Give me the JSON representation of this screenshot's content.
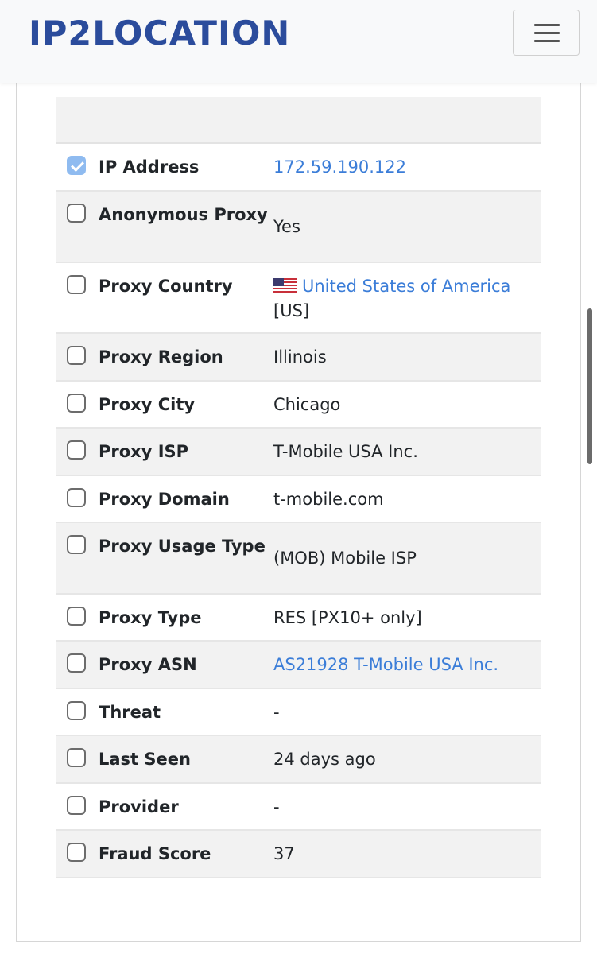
{
  "header": {
    "logo_text": "IP2LOCATION",
    "menu_icon": "hamburger-icon"
  },
  "table": {
    "rows": [
      {
        "label": "IP Address",
        "value": "172.59.190.122",
        "checked": true,
        "link": true
      },
      {
        "label": "Anonymous Proxy",
        "value": "Yes",
        "checked": false,
        "link": false
      },
      {
        "label": "Proxy Country",
        "value": "United States of America",
        "value_suffix": "[US]",
        "checked": false,
        "link": true,
        "flag": "us-flag-icon"
      },
      {
        "label": "Proxy Region",
        "value": "Illinois",
        "checked": false,
        "link": false
      },
      {
        "label": "Proxy City",
        "value": "Chicago",
        "checked": false,
        "link": false
      },
      {
        "label": "Proxy ISP",
        "value": "T-Mobile USA Inc.",
        "checked": false,
        "link": false
      },
      {
        "label": "Proxy Domain",
        "value": "t-mobile.com",
        "checked": false,
        "link": false
      },
      {
        "label": "Proxy Usage Type",
        "value": "(MOB) Mobile ISP",
        "checked": false,
        "link": false
      },
      {
        "label": "Proxy Type",
        "value": "RES [PX10+ only]",
        "checked": false,
        "link": false
      },
      {
        "label": "Proxy ASN",
        "value": "AS21928 T-Mobile USA Inc.",
        "checked": false,
        "link": true
      },
      {
        "label": "Threat",
        "value": "-",
        "checked": false,
        "link": false
      },
      {
        "label": "Last Seen",
        "value": "24 days ago",
        "checked": false,
        "link": false
      },
      {
        "label": "Provider",
        "value": "-",
        "checked": false,
        "link": false
      },
      {
        "label": "Fraud Score",
        "value": "37",
        "checked": false,
        "link": false
      }
    ]
  },
  "colors": {
    "brand": "#2b4c9c",
    "link": "#3b7dd8",
    "row_alt": "#f2f2f2"
  }
}
